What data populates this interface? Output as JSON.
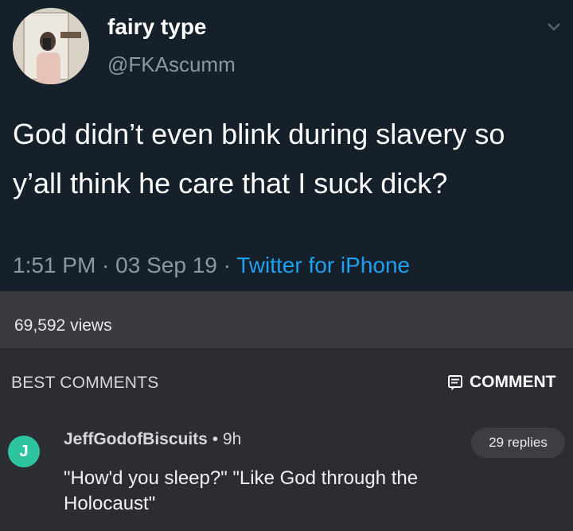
{
  "tweet": {
    "display_name": "fairy type",
    "handle": "@FKAscumm",
    "text": "God didn’t even blink during slavery so y’all think he care that I suck dick?",
    "time": "1:51 PM",
    "date": "03 Sep 19",
    "source": "Twitter for iPhone",
    "separator": " · ",
    "avatar_icon": "profile-photo",
    "caret_icon": "chevron-down-icon"
  },
  "stats": {
    "views": "69,592 views"
  },
  "comments_header": {
    "best_label": "BEST COMMENTS",
    "comment_button_label": "COMMENT",
    "comment_icon": "comment-icon"
  },
  "comment": {
    "avatar_letter": "J",
    "username": "JeffGodofBiscuits",
    "time": "9h",
    "time_separator": " • ",
    "replies": "29 replies",
    "text": "\"How'd you sleep?\" \"Like God through the Holocaust\""
  },
  "colors": {
    "tweet_bg": "#15202b",
    "link_blue": "#1da1f2",
    "muted_gray": "#8899a6",
    "app_bg": "#2c2d33",
    "comment_avatar": "#2ec4a0"
  }
}
